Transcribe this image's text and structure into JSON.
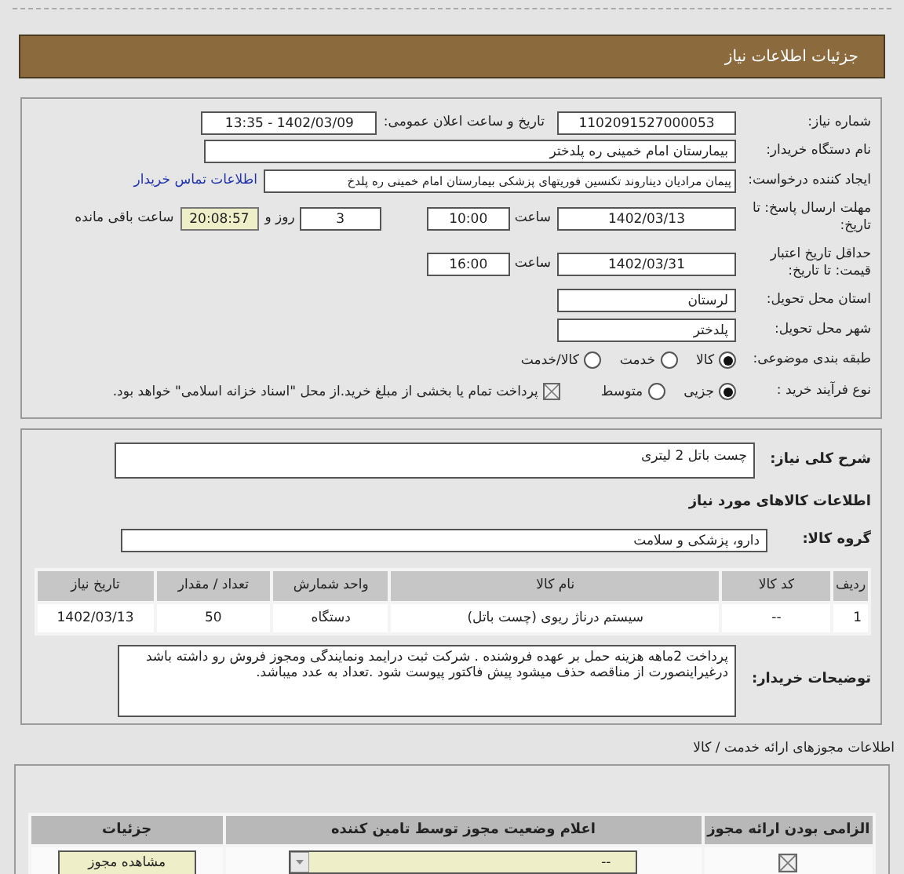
{
  "header": {
    "title": "جزئیات اطلاعات نیاز"
  },
  "need_number": {
    "label": "شماره نیاز:",
    "value": "1102091527000053"
  },
  "announce_datetime": {
    "label": "تاریخ و ساعت اعلان عمومی:",
    "value": "1402/03/09 - 13:35"
  },
  "buyer_org": {
    "label": "نام دستگاه خریدار:",
    "value": "بیمارستان امام خمینی ره پلدختر"
  },
  "requester": {
    "label": "ایجاد کننده درخواست:",
    "value": "پیمان مرادیان دیناروند تکنسین فوریتهای پزشکی بیمارستان امام خمینی ره پلدخ",
    "link": "اطلاعات تماس خریدار"
  },
  "response_deadline": {
    "label": "مهلت ارسال پاسخ: تا تاریخ:",
    "date": "1402/03/13",
    "time_label": "ساعت",
    "time": "10:00",
    "days": "3",
    "days_label": "روز و",
    "remaining": "20:08:57",
    "remaining_label": "ساعت باقی مانده"
  },
  "price_validity": {
    "label": "حداقل تاریخ اعتبار قیمت: تا تاریخ:",
    "date": "1402/03/31",
    "time_label": "ساعت",
    "time": "16:00"
  },
  "province": {
    "label": "استان محل تحویل:",
    "value": "لرستان"
  },
  "city": {
    "label": "شهر محل تحویل:",
    "value": "پلدختر"
  },
  "category": {
    "label": "طبقه بندی موضوعی:",
    "options": [
      {
        "label": "کالا",
        "selected": true
      },
      {
        "label": "خدمت",
        "selected": false
      },
      {
        "label": "کالا/خدمت",
        "selected": false
      }
    ]
  },
  "purchase_process": {
    "label": "نوع فرآیند خرید :",
    "options": [
      {
        "label": "جزیی",
        "selected": true
      },
      {
        "label": "متوسط",
        "selected": false
      }
    ],
    "payment_note": {
      "label": "پرداخت تمام یا بخشی از مبلغ خرید.از محل \"اسناد خزانه اسلامی\" خواهد بود.",
      "checked": false
    }
  },
  "description": {
    "label": "شرح کلی نیاز:",
    "value": "چست باتل 2 لیتری"
  },
  "goods_heading": "اطلاعات کالاهای مورد نیاز",
  "goods_group": {
    "label": "گروه کالا:",
    "value": "دارو، پزشکی و سلامت"
  },
  "goods_table": {
    "columns": [
      "ردیف",
      "کد کالا",
      "نام کالا",
      "واحد شمارش",
      "تعداد / مقدار",
      "تاریخ نیاز"
    ],
    "rows": [
      [
        "1",
        "--",
        "سیستم درناژ ریوی (چست باتل)",
        "دستگاه",
        "50",
        "1402/03/13"
      ]
    ]
  },
  "buyer_notes": {
    "label": "توضیحات خریدار:",
    "value": "پرداخت 2ماهه هزینه حمل بر عهده فروشنده . شرکت ثبت درایمد ونمایندگی ومجوز فروش رو داشته باشد درغیراینصورت از مناقصه حذف میشود پیش فاکتور پیوست شود .تعداد به عدد میباشد."
  },
  "permits": {
    "title": "اطلاعات مجوزهای ارائه خدمت / کالا",
    "columns": [
      "الزامی بودن ارائه مجوز",
      "اعلام وضعیت مجوز توسط تامین کننده",
      "جزئیات"
    ],
    "rows": [
      {
        "required": false,
        "status": "--",
        "button": "مشاهده مجوز"
      }
    ]
  }
}
